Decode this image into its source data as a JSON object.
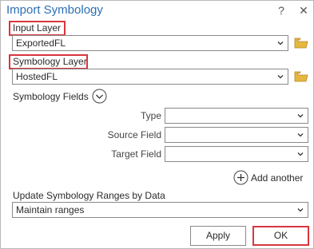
{
  "dialog": {
    "title": "Import Symbology",
    "help_glyph": "?",
    "close_glyph": "✕"
  },
  "input_layer": {
    "label": "Input Layer",
    "value": "ExportedFL"
  },
  "symbology_layer": {
    "label": "Symbology Layer",
    "value": "HostedFL"
  },
  "symbology_fields": {
    "label": "Symbology Fields",
    "type_label": "Type",
    "type_value": "",
    "source_field_label": "Source Field",
    "source_field_value": "",
    "target_field_label": "Target Field",
    "target_field_value": "",
    "add_another_label": "Add another"
  },
  "update_ranges": {
    "label": "Update Symbology Ranges by Data",
    "value": "Maintain ranges"
  },
  "buttons": {
    "apply": "Apply",
    "ok": "OK"
  },
  "colors": {
    "title": "#2b6fb6",
    "highlight": "#d9363e",
    "folder": "#e6b73f"
  },
  "icons": {
    "help": "question-mark-icon",
    "close": "close-icon",
    "browse": "folder-icon",
    "expand": "chevron-down-circle-icon",
    "add": "plus-circle-icon"
  }
}
